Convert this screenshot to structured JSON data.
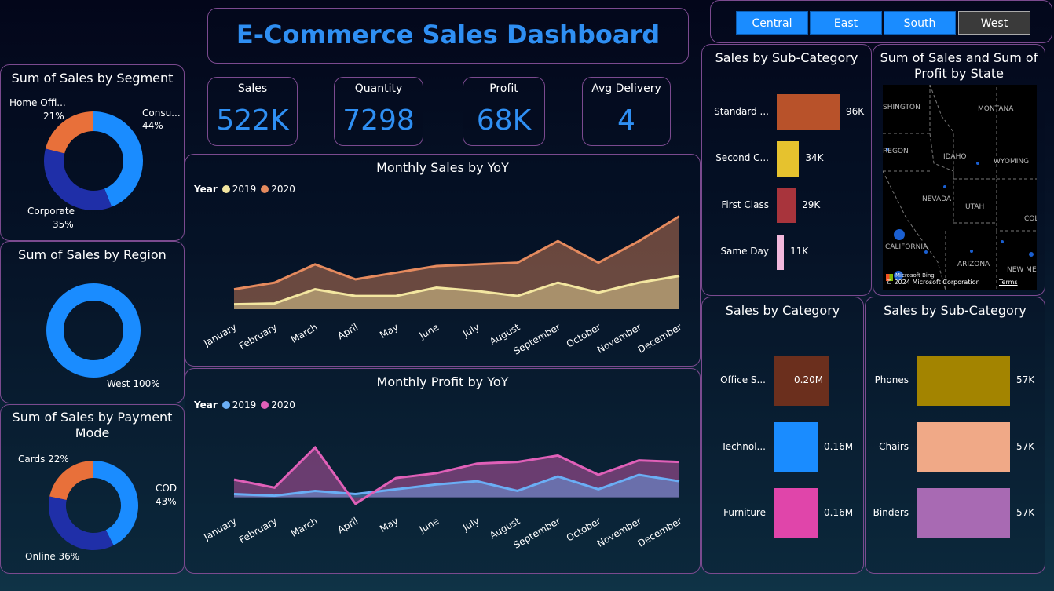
{
  "title": "E-Commerce Sales Dashboard",
  "slicer": {
    "options": [
      {
        "label": "Central",
        "selected": true
      },
      {
        "label": "East",
        "selected": true
      },
      {
        "label": "South",
        "selected": true
      },
      {
        "label": "West",
        "selected": false
      }
    ]
  },
  "kpis": [
    {
      "label": "Sales",
      "value": "522K"
    },
    {
      "label": "Quantity",
      "value": "7298"
    },
    {
      "label": "Profit",
      "value": "68K"
    },
    {
      "label": "Avg Delivery",
      "value": "4"
    }
  ],
  "months": [
    "January",
    "February",
    "March",
    "April",
    "May",
    "June",
    "July",
    "August",
    "September",
    "October",
    "November",
    "December"
  ],
  "segment": {
    "title": "Sum of Sales by Segment",
    "labels": {
      "consumer": "Consu...",
      "consumer_pct": "44%",
      "home": "Home Offi...",
      "home_pct": "21%",
      "corporate": "Corporate",
      "corporate_pct": "35%"
    }
  },
  "region": {
    "title": "Sum of Sales by Region",
    "label": "West 100%"
  },
  "payment": {
    "title": "Sum of Sales by Payment Mode",
    "labels": {
      "cards": "Cards 22%",
      "cod": "COD",
      "cod_pct": "43%",
      "online": "Online 36%"
    }
  },
  "sales_yoy": {
    "title": "Monthly Sales by YoY",
    "legend_title": "Year",
    "legend": [
      "2019",
      "2020"
    ]
  },
  "profit_yoy": {
    "title": "Monthly Profit by YoY",
    "legend_title": "Year",
    "legend": [
      "2019",
      "2020"
    ]
  },
  "subcat_ship": {
    "title": "Sales by Sub-Category",
    "labels": [
      "Standard ...",
      "Second C...",
      "First Class",
      "Same Day"
    ],
    "value_labels": [
      "96K",
      "34K",
      "29K",
      "11K"
    ]
  },
  "map": {
    "title": "Sum of Sales and Sum of Profit by State",
    "states": [
      "SHINGTON",
      "MONTANA",
      "REGON",
      "IDAHO",
      "WYOMING",
      "NEVADA",
      "UTAH",
      "COLORA",
      "CALIFORNIA",
      "ARIZONA",
      "NEW MEX"
    ],
    "attribution": "© 2024 Microsoft Corporation",
    "terms": "Terms",
    "brand": "Microsoft Bing"
  },
  "category": {
    "title": "Sales by Category",
    "labels": [
      "Office S...",
      "Technol...",
      "Furniture"
    ],
    "value_labels": [
      "0.20M",
      "0.16M",
      "0.16M"
    ]
  },
  "subcat_products": {
    "title": "Sales by Sub-Category",
    "labels": [
      "Phones",
      "Chairs",
      "Binders"
    ],
    "value_labels": [
      "57K",
      "57K",
      "57K"
    ]
  },
  "colors": {
    "accent": "#2f8ff3",
    "y2019_sales": "#f3e6a0",
    "y2020_sales": "#e58a5e",
    "y2019_profit": "#6aaef5",
    "y2020_profit": "#e060b8"
  },
  "chart_data": [
    {
      "type": "pie",
      "title": "Sum of Sales by Segment",
      "categories": [
        "Consumer",
        "Corporate",
        "Home Office"
      ],
      "values": [
        44,
        35,
        21
      ],
      "colors": [
        "#1a8cff",
        "#1f2fa8",
        "#e8703a"
      ]
    },
    {
      "type": "pie",
      "title": "Sum of Sales by Region",
      "categories": [
        "West"
      ],
      "values": [
        100
      ],
      "colors": [
        "#1a8cff"
      ]
    },
    {
      "type": "pie",
      "title": "Sum of Sales by Payment Mode",
      "categories": [
        "COD",
        "Online",
        "Cards"
      ],
      "values": [
        43,
        36,
        22
      ],
      "colors": [
        "#1a8cff",
        "#1f2fa8",
        "#e8703a"
      ]
    },
    {
      "type": "area",
      "title": "Monthly Sales by YoY",
      "categories": [
        "January",
        "February",
        "March",
        "April",
        "May",
        "June",
        "July",
        "August",
        "September",
        "October",
        "November",
        "December"
      ],
      "series": [
        {
          "name": "2019",
          "values": [
            3,
            3.5,
            12,
            8,
            8,
            13,
            11,
            8,
            16,
            10,
            16,
            20
          ]
        },
        {
          "name": "2020",
          "values": [
            12,
            16,
            27,
            18,
            22,
            26,
            27,
            28,
            41,
            28,
            41,
            56
          ]
        }
      ],
      "ylim": [
        0,
        60
      ]
    },
    {
      "type": "area",
      "title": "Monthly Profit by YoY",
      "categories": [
        "January",
        "February",
        "March",
        "April",
        "May",
        "June",
        "July",
        "August",
        "September",
        "October",
        "November",
        "December"
      ],
      "series": [
        {
          "name": "2019",
          "values": [
            2,
            1,
            4,
            2,
            5,
            8,
            10,
            4,
            13,
            5,
            14,
            10
          ]
        },
        {
          "name": "2020",
          "values": [
            11,
            6,
            31,
            -4,
            12,
            15,
            21,
            22,
            26,
            14,
            23,
            22
          ]
        }
      ],
      "ylim": [
        -8,
        36
      ]
    },
    {
      "type": "bar",
      "title": "Sales by Sub-Category",
      "categories": [
        "Standard ...",
        "Second C...",
        "First Class",
        "Same Day"
      ],
      "values": [
        96,
        34,
        29,
        11
      ],
      "colors": [
        "#b8522a",
        "#e6c22e",
        "#a8343c",
        "#f2b8dc"
      ]
    },
    {
      "type": "bar",
      "title": "Sales by Category",
      "categories": [
        "Office S...",
        "Technol...",
        "Furniture"
      ],
      "values": [
        0.2,
        0.16,
        0.16
      ],
      "colors": [
        "#6b2f1d",
        "#1a8cff",
        "#e045aa"
      ]
    },
    {
      "type": "bar",
      "title": "Sales by Sub-Category",
      "categories": [
        "Phones",
        "Chairs",
        "Binders"
      ],
      "values": [
        57,
        57,
        57
      ],
      "colors": [
        "#a38400",
        "#f0a987",
        "#a86ab3"
      ]
    }
  ]
}
